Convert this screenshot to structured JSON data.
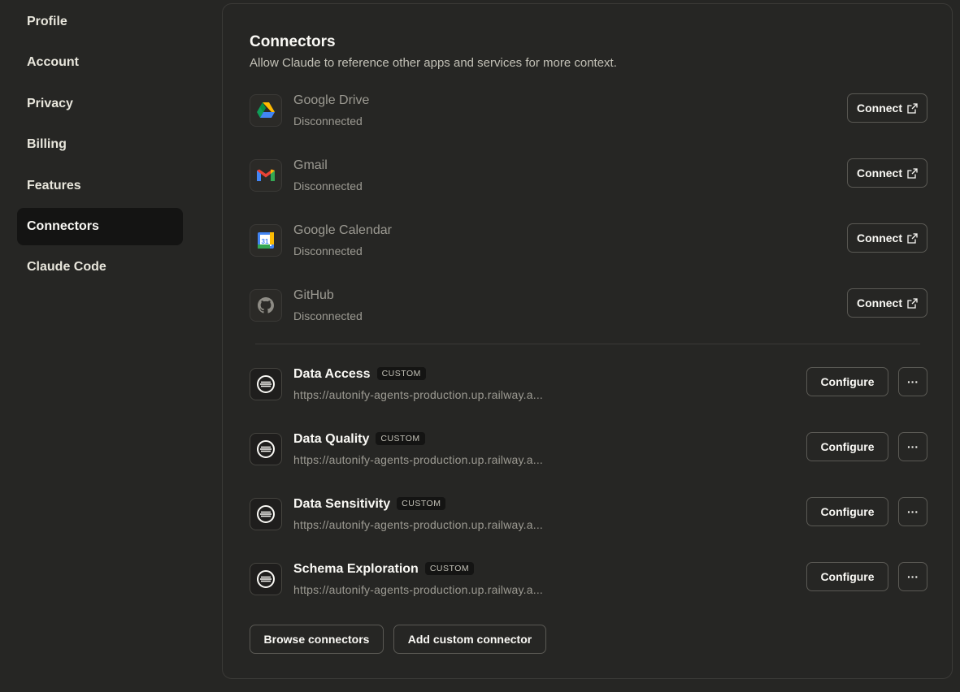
{
  "sidebar": {
    "items": [
      {
        "label": "Profile"
      },
      {
        "label": "Account"
      },
      {
        "label": "Privacy"
      },
      {
        "label": "Billing"
      },
      {
        "label": "Features"
      },
      {
        "label": "Connectors",
        "active": true
      },
      {
        "label": "Claude Code"
      }
    ]
  },
  "connectors": {
    "title": "Connectors",
    "subtitle": "Allow Claude to reference other apps and services for more context.",
    "builtin": [
      {
        "name": "Google Drive",
        "status": "Disconnected",
        "icon": "google-drive-icon",
        "button": "Connect"
      },
      {
        "name": "Gmail",
        "status": "Disconnected",
        "icon": "gmail-icon",
        "button": "Connect"
      },
      {
        "name": "Google Calendar",
        "status": "Disconnected",
        "icon": "google-calendar-icon",
        "button": "Connect"
      },
      {
        "name": "GitHub",
        "status": "Disconnected",
        "icon": "github-icon",
        "button": "Connect"
      }
    ],
    "custom": [
      {
        "name": "Data Access",
        "badge": "CUSTOM",
        "url": "https://autonify-agents-production.up.railway.a...",
        "button": "Configure",
        "more": "···"
      },
      {
        "name": "Data Quality",
        "badge": "CUSTOM",
        "url": "https://autonify-agents-production.up.railway.a...",
        "button": "Configure",
        "more": "···"
      },
      {
        "name": "Data Sensitivity",
        "badge": "CUSTOM",
        "url": "https://autonify-agents-production.up.railway.a...",
        "button": "Configure",
        "more": "···"
      },
      {
        "name": "Schema Exploration",
        "badge": "CUSTOM",
        "url": "https://autonify-agents-production.up.railway.a...",
        "button": "Configure",
        "more": "···"
      }
    ],
    "browse_label": "Browse connectors",
    "add_custom_label": "Add custom connector"
  },
  "colors": {
    "background": "#262624",
    "sidebar_active": "#141413",
    "text": "#faf9f5",
    "muted": "#9c9a92",
    "border": "#5a5954"
  }
}
